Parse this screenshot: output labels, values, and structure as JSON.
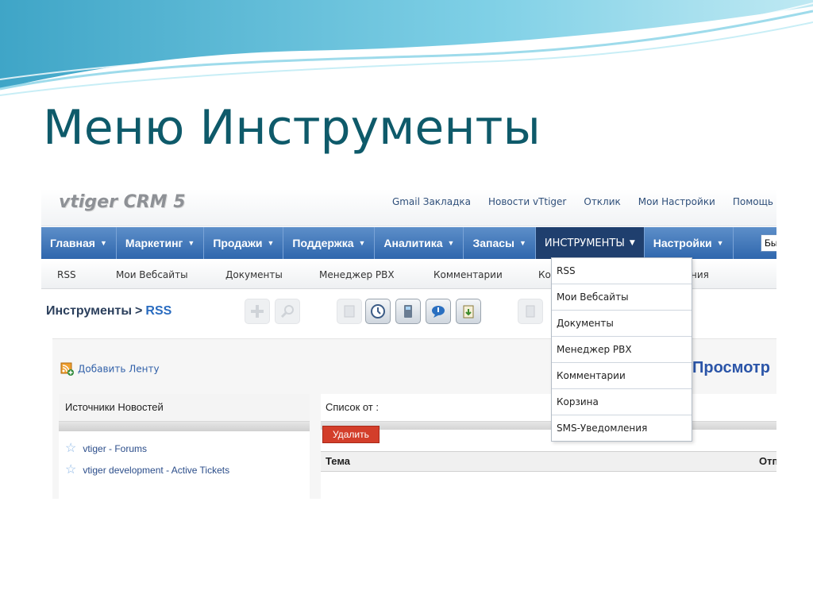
{
  "slide": {
    "title": "Меню Инструменты"
  },
  "app": {
    "logo": "vtiger CRM 5",
    "top_links": [
      "Gmail Закладка",
      "Новости vTtiger",
      "Отклик",
      "Мои Настройки",
      "Помощь"
    ],
    "nav": [
      {
        "label": "Главная"
      },
      {
        "label": "Маркетинг"
      },
      {
        "label": "Продажи"
      },
      {
        "label": "Поддержка"
      },
      {
        "label": "Аналитика"
      },
      {
        "label": "Запасы"
      },
      {
        "label": "ИНСТРУМЕНТЫ"
      },
      {
        "label": "Настройки"
      }
    ],
    "nav_search_value": "Бы",
    "subnav": [
      "RSS",
      "Мои Вебсайты",
      "Документы",
      "Менеджер PBX",
      "Комментарии",
      "Ко",
      "ния"
    ],
    "breadcrumb": {
      "parent": "Инструменты",
      "separator": ">",
      "current": "RSS"
    },
    "toolbar_icons": [
      "add-icon",
      "search-icon",
      "calendar-icon",
      "clock-icon",
      "calculator-icon",
      "chat-icon",
      "clipboard-icon",
      "import-icon"
    ],
    "add_feed_label": "Добавить Ленту",
    "preview_heading": "Просмотр",
    "news_sources": {
      "header": "Источники Новостей",
      "items": [
        "vtiger - Forums",
        "vtiger development - Active Tickets"
      ]
    },
    "list": {
      "header": "Список от :",
      "delete_button": "Удалить",
      "col_subject": "Тема",
      "col_sender": "Отп"
    },
    "dropdown": [
      "RSS",
      "Мои Вебсайты",
      "Документы",
      "Менеджер PBX",
      "Комментарии",
      "Корзина",
      "SMS-Уведомления"
    ]
  }
}
